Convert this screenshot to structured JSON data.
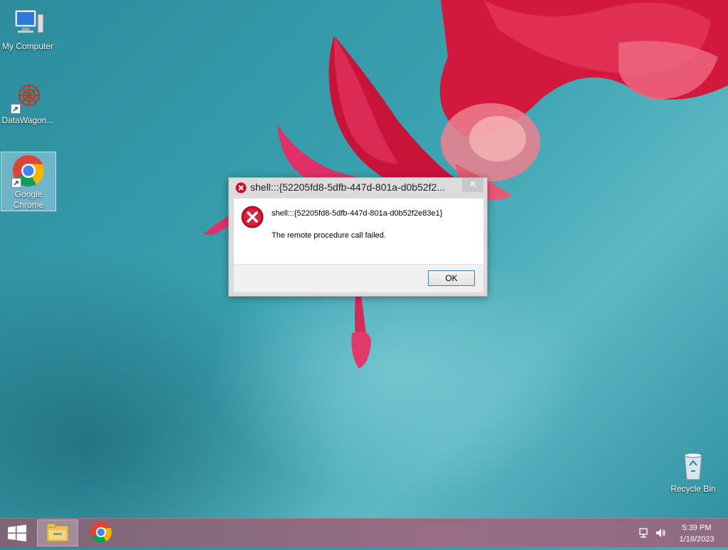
{
  "desktop": {
    "icons": [
      {
        "label": "My Computer"
      },
      {
        "label": "DataWagon..."
      },
      {
        "label": "Google\nChrome"
      },
      {
        "label": "Recycle Bin"
      }
    ]
  },
  "dialog": {
    "title": "shell:::{52205fd8-5dfb-447d-801a-d0b52f2...",
    "close_label": "✕",
    "message": "shell:::{52205fd8-5dfb-447d-801a-d0b52f2e83e1}",
    "detail": "The remote procedure call failed.",
    "ok_label": "OK"
  },
  "taskbar": {
    "time": "5:39 PM",
    "date": "1/16/2023",
    "apps": [
      {
        "name": "file-explorer",
        "active": true
      },
      {
        "name": "google-chrome",
        "active": false
      }
    ]
  },
  "colors": {
    "accent_error": "#c8102e",
    "taskbar": "#8a6a7f",
    "desktop": "#3aa2b0"
  }
}
